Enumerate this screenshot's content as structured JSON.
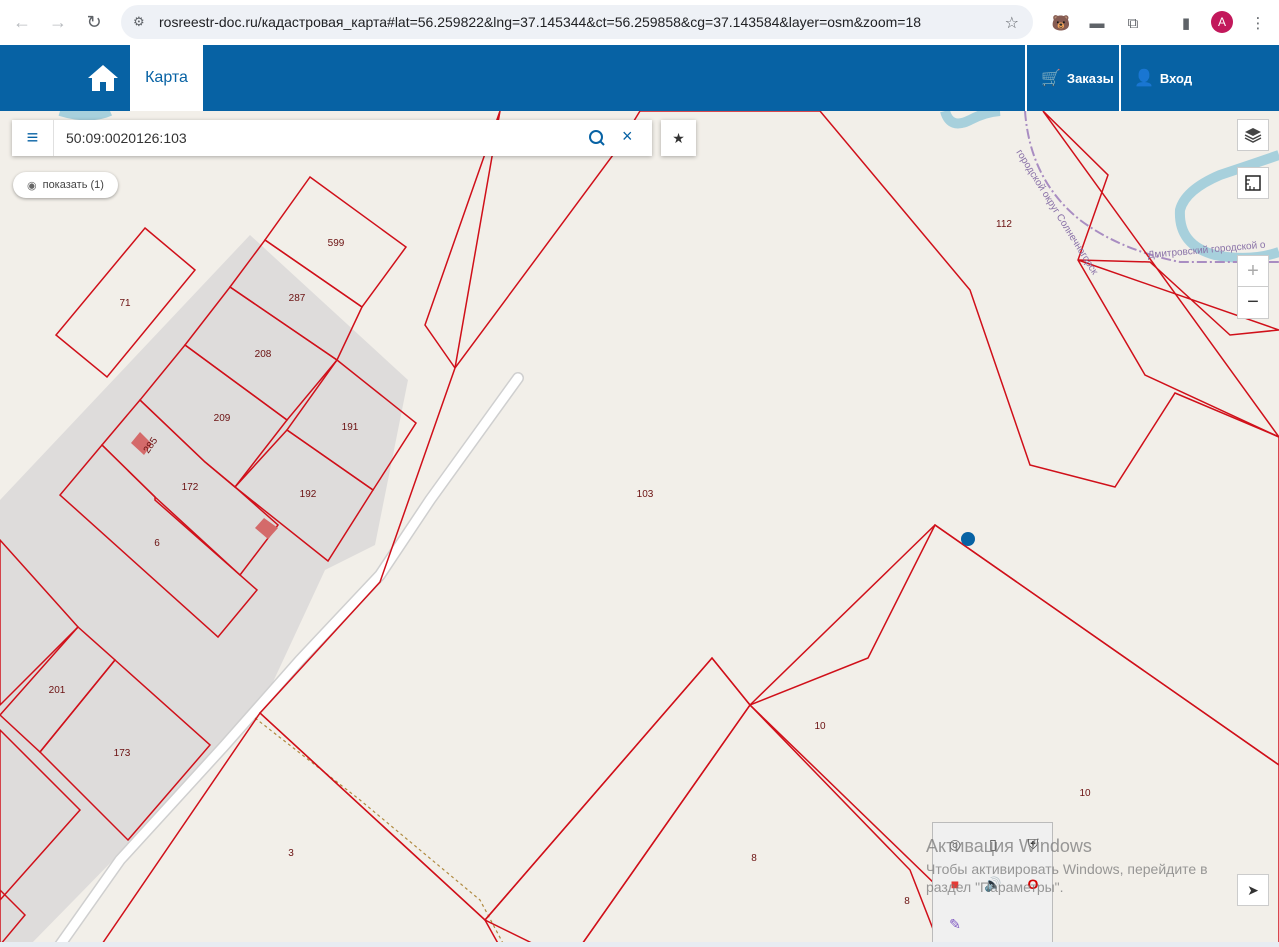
{
  "browser": {
    "url": "rosreestr-doc.ru/кадастровая_карта#lat=56.259822&lng=37.145344&ct=56.259858&cg=37.143584&layer=osm&zoom=18",
    "avatar_letter": "A"
  },
  "header": {
    "tab_map": "Карта",
    "orders": "Заказы",
    "login": "Вход"
  },
  "search": {
    "value": "50:09:0020126:103",
    "show_label": "показать (1)"
  },
  "map": {
    "parcel_labels": [
      "599",
      "287",
      "71",
      "208",
      "209",
      "191",
      "285",
      "172",
      "192",
      "6",
      "201",
      "173",
      "3",
      "103",
      "112",
      "10",
      "10",
      "8",
      "8"
    ],
    "road_label_1": "городской округ Солнечногорск",
    "road_label_2": "Дмитровский городской о"
  },
  "windows_watermark": {
    "line1": "Активация Windows",
    "line2": "Чтобы активировать Windows, перейдите в",
    "line3": "раздел \"Параметры\"."
  },
  "colors": {
    "header_blue": "#0762a4",
    "parcel_red": "#d0101a",
    "river_blue": "#a7d0dc"
  }
}
